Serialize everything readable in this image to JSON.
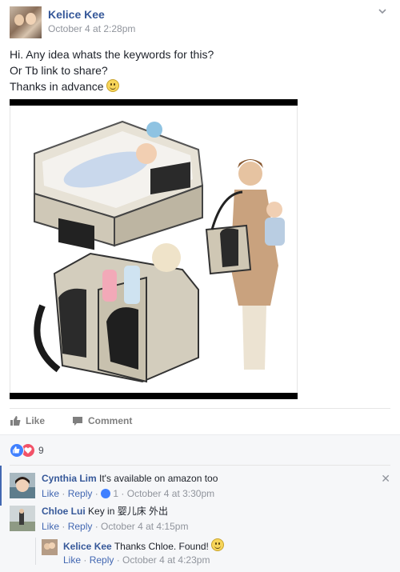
{
  "post": {
    "author": "Kelice Kee",
    "timestamp": "October 4 at 2:28pm",
    "lines": [
      "Hi. Any idea whats the keywords for this?",
      "Or Tb link to share?",
      "Thanks in advance"
    ],
    "photo_icon": "product-photo-baby-bag-bassinet"
  },
  "actions": {
    "like_label": "Like",
    "comment_label": "Comment"
  },
  "reactions": {
    "count": "9",
    "icons": [
      "like-reaction-icon",
      "love-reaction-icon"
    ]
  },
  "comments": [
    {
      "name": "Cynthia Lim",
      "text": "It's available on amazon too",
      "like": "Like",
      "reply": "Reply",
      "likes": "1",
      "time": "October 4 at 3:30pm"
    },
    {
      "name": "Chloe Lui",
      "text": "Key in 婴儿床 外出",
      "like": "Like",
      "reply": "Reply",
      "time": "October 4 at 4:15pm"
    },
    {
      "name": "Kelice Kee",
      "text": "Thanks Chloe. Found!",
      "like": "Like",
      "reply": "Reply",
      "time": "October 4 at 4:23pm"
    }
  ],
  "colors": {
    "link_blue": "#365899",
    "meta_gray": "#90949c",
    "like_blue": "#4080ff",
    "love_red": "#f25268",
    "comments_bg": "#f6f7f9"
  }
}
